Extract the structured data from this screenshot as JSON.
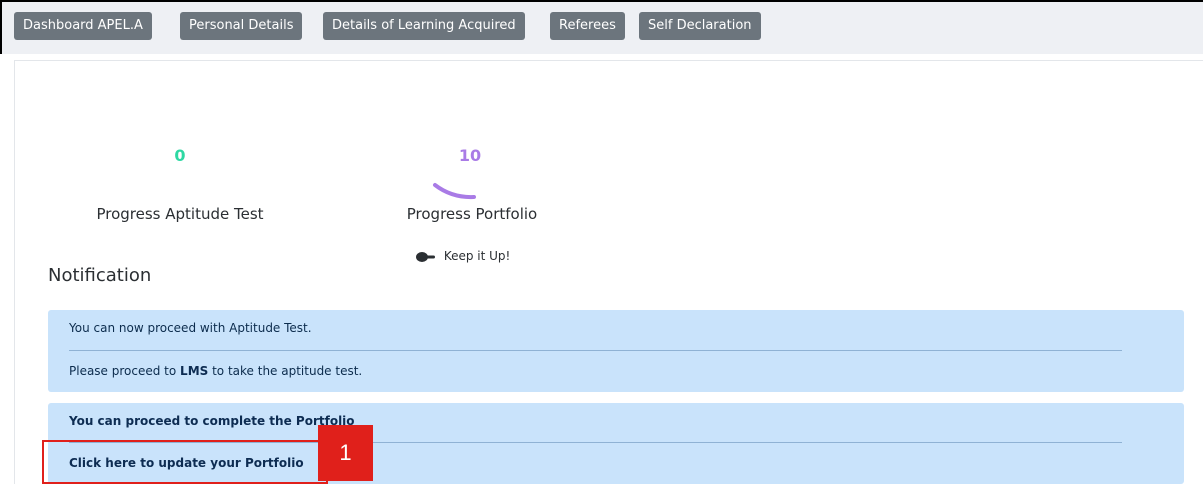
{
  "tabs": [
    {
      "label": "Dashboard APEL.A"
    },
    {
      "label": "Personal Details"
    },
    {
      "label": "Details of Learning Acquired"
    },
    {
      "label": "Referees"
    },
    {
      "label": "Self Declaration"
    }
  ],
  "stats": {
    "aptitude": {
      "value": "0",
      "label": "Progress Aptitude Test",
      "progress_percent": 0,
      "color": "#2ed8a3"
    },
    "portfolio": {
      "value": "10",
      "label": "Progress Portfolio",
      "progress_percent": 10,
      "color": "#a97be6"
    }
  },
  "encouragement": {
    "icon": "pointing-hand-icon",
    "text": "Keep it Up!"
  },
  "notification": {
    "title": "Notification",
    "aptitude_alert": {
      "line1": "You can now proceed with Aptitude Test.",
      "line2_prefix": "Please proceed to ",
      "line2_link": "LMS",
      "line2_suffix": " to take the aptitude test."
    },
    "portfolio_alert": {
      "line1": "You can proceed to complete the Portfolio",
      "line2": "Click here to update your Portfolio"
    }
  },
  "annotation": {
    "badge": "1",
    "color": "#e0201b"
  }
}
